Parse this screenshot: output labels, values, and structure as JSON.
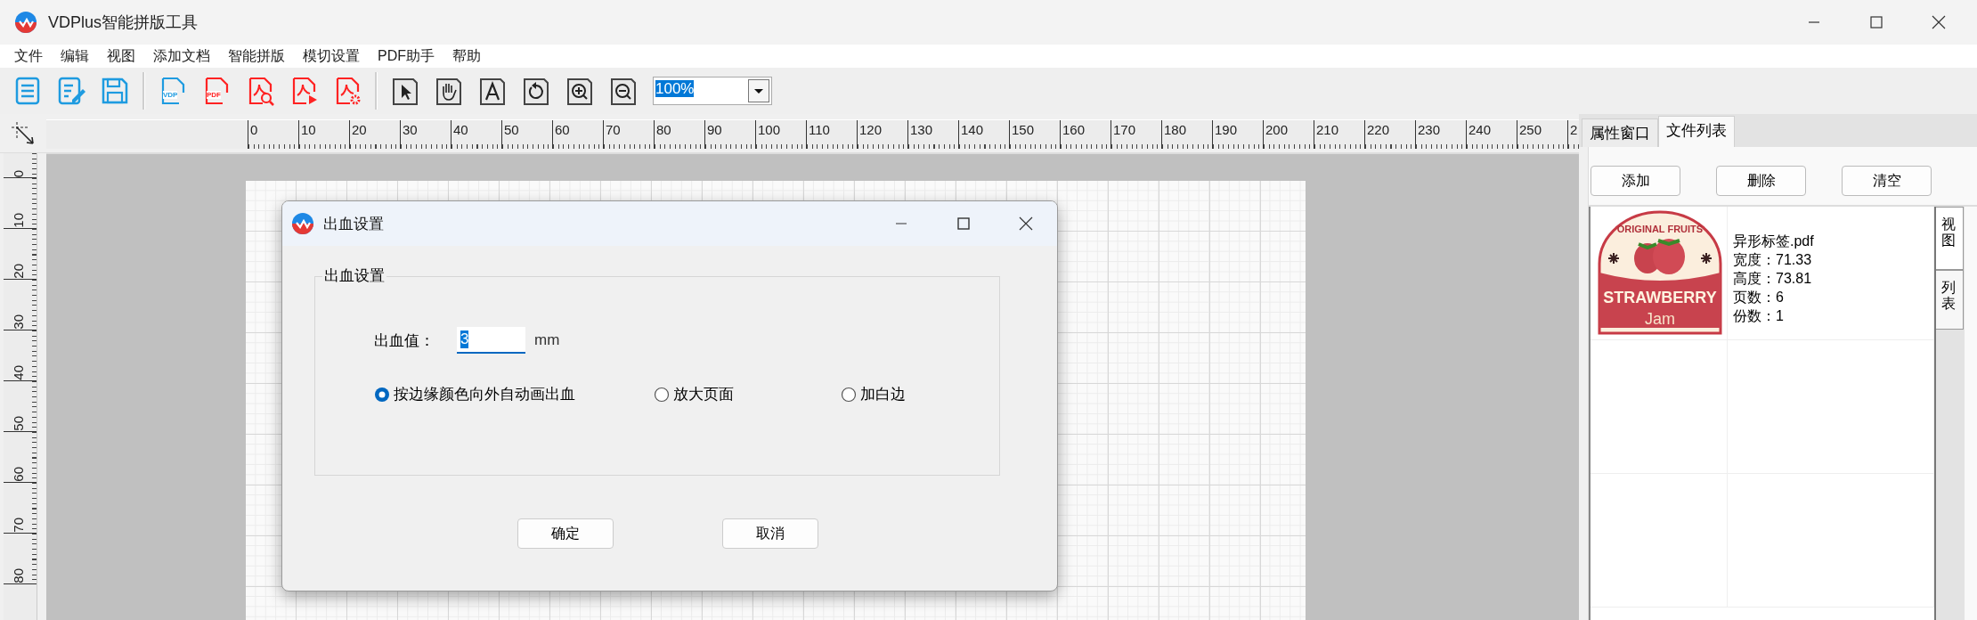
{
  "window": {
    "title": "VDPlus智能拼版工具"
  },
  "menu": [
    "文件",
    "编辑",
    "视图",
    "添加文档",
    "智能拼版",
    "模切设置",
    "PDF助手",
    "帮助"
  ],
  "toolbar": {
    "groups": [
      [
        {
          "kind": "list"
        },
        {
          "kind": "edit"
        },
        {
          "kind": "save"
        }
      ],
      [
        {
          "kind": "vdp",
          "text": "VDP"
        },
        {
          "kind": "pdf",
          "text": "PDF"
        },
        {
          "kind": "pdf-search"
        },
        {
          "kind": "pdf-play"
        },
        {
          "kind": "pdf-gear"
        }
      ],
      [
        {
          "kind": "pointer"
        },
        {
          "kind": "hand"
        },
        {
          "kind": "text"
        },
        {
          "kind": "rotate"
        },
        {
          "kind": "zoom-in"
        },
        {
          "kind": "zoom-out"
        }
      ]
    ],
    "zoom": "100%"
  },
  "rulers": {
    "horizontal": [
      "0",
      "10",
      "20",
      "30",
      "40",
      "50",
      "60",
      "70",
      "80",
      "90",
      "100",
      "110",
      "120",
      "130",
      "140",
      "150",
      "160",
      "170",
      "180",
      "190",
      "200",
      "210",
      "220",
      "230",
      "240",
      "250",
      "2"
    ],
    "vertical": [
      "0",
      "10",
      "20",
      "30",
      "40",
      "50",
      "60",
      "70",
      "80"
    ]
  },
  "panel": {
    "tabs": [
      {
        "label": "属性窗口",
        "selected": false
      },
      {
        "label": "文件列表",
        "selected": true
      }
    ],
    "buttons": [
      "添加",
      "删除",
      "清空"
    ],
    "side_tabs": [
      {
        "label": "视图",
        "selected": true
      },
      {
        "label": "列表",
        "selected": false
      }
    ],
    "files": [
      {
        "name": "异形标签.pdf",
        "artwork": [
          "ORIGINAL FRUITS",
          "STRAWBERRY",
          "Jam"
        ],
        "details": [
          {
            "label": "宽度：",
            "value": "71.33"
          },
          {
            "label": "高度：",
            "value": "73.81"
          },
          {
            "label": "页数：",
            "value": "6"
          },
          {
            "label": "份数：",
            "value": "1"
          }
        ]
      }
    ]
  },
  "dialog": {
    "title": "出血设置",
    "group": "出血设置",
    "bleed_label": "出血值：",
    "bleed_value": "3",
    "unit": "mm",
    "options": [
      {
        "label": "按边缘颜色向外自动画出血",
        "selected": true
      },
      {
        "label": "放大页面",
        "selected": false
      },
      {
        "label": "加白边",
        "selected": false
      }
    ],
    "buttons": [
      "确定",
      "取消"
    ]
  }
}
